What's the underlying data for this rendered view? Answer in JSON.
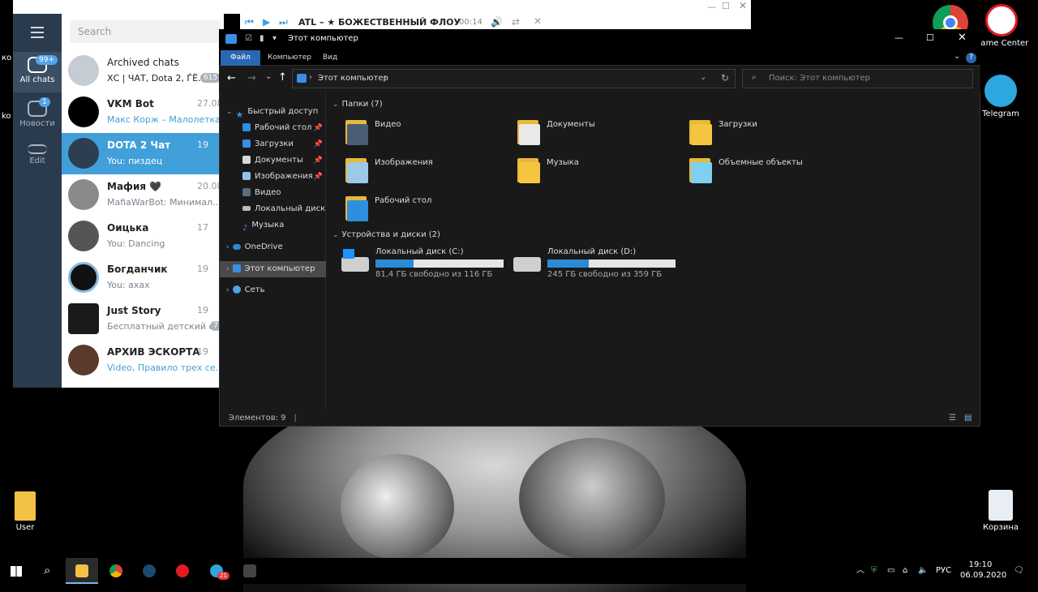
{
  "desktop": {
    "icons": [
      {
        "label": "Game Center"
      },
      {
        "label": "Telegram"
      },
      {
        "label": "User"
      },
      {
        "label": "Корзина"
      }
    ],
    "left_edge_labels": [
      "ко",
      "ko"
    ]
  },
  "telegram": {
    "search_placeholder": "Search",
    "sidebar": [
      {
        "label": "All chats",
        "badge": "99+"
      },
      {
        "label": "Новости",
        "badge": "1"
      },
      {
        "label": "Edit"
      }
    ],
    "player": {
      "title": "ATL – ★ БОЖЕСТВЕННЫЙ ФЛОУ",
      "time": "00:14"
    },
    "chats": [
      {
        "name": "Archived chats",
        "message": "ХС | ЧАТ, Dota 2, ЃЁ...",
        "date": "",
        "badge": "615"
      },
      {
        "name": "VKM Bot",
        "message": "Макс Корж – Малолетка",
        "date": "27.08"
      },
      {
        "name": "DOTA 2 Чат",
        "message": "You: пиздец",
        "date": "19"
      },
      {
        "name": "Мафия 🖤",
        "message": "MafiaWarBot: Минимал...",
        "date": "20.08"
      },
      {
        "name": "Оицька",
        "message": "You: Dancing",
        "date": "17"
      },
      {
        "name": "Богданчик",
        "message": "You: ахах",
        "date": "19"
      },
      {
        "name": "Just Story",
        "message": "Бесплатный детский с...",
        "date": "19",
        "badge": "7"
      },
      {
        "name": "АРХИВ ЭСКОРТА",
        "message": "Video, Правило трех се...",
        "date": "19"
      }
    ]
  },
  "explorer": {
    "title": "Этот компьютер",
    "ribbon_tabs": [
      "Файл",
      "Компьютер",
      "Вид"
    ],
    "address": "Этот компьютер",
    "search_placeholder": "Поиск: Этот компьютер",
    "nav": {
      "quick_access": "Быстрый доступ",
      "quick_items": [
        "Рабочий стол",
        "Загрузки",
        "Документы",
        "Изображения",
        "Видео",
        "Локальный диск (D",
        "Музыка"
      ],
      "onedrive": "OneDrive",
      "this_pc": "Этот компьютер",
      "network": "Сеть"
    },
    "folders_header": "Папки (7)",
    "folders": [
      "Видео",
      "Документы",
      "Загрузки",
      "Изображения",
      "Музыка",
      "Объемные объекты",
      "Рабочий стол"
    ],
    "devices_header": "Устройства и диски (2)",
    "drives": [
      {
        "name": "Локальный диск (C:)",
        "free": "81,4 ГБ свободно из 116 ГБ",
        "used_fraction": 0.3
      },
      {
        "name": "Локальный диск (D:)",
        "free": "245 ГБ свободно из 359 ГБ",
        "used_fraction": 0.32
      }
    ],
    "status": "Элементов: 9"
  },
  "taskbar": {
    "lang": "РУС",
    "time": "19:10",
    "date": "06.09.2020",
    "telegram_badge": "21"
  },
  "colors": {
    "accent": "#2a67b1",
    "telegram_active": "#419fd9",
    "drive_bar": "#2a8ad4"
  }
}
